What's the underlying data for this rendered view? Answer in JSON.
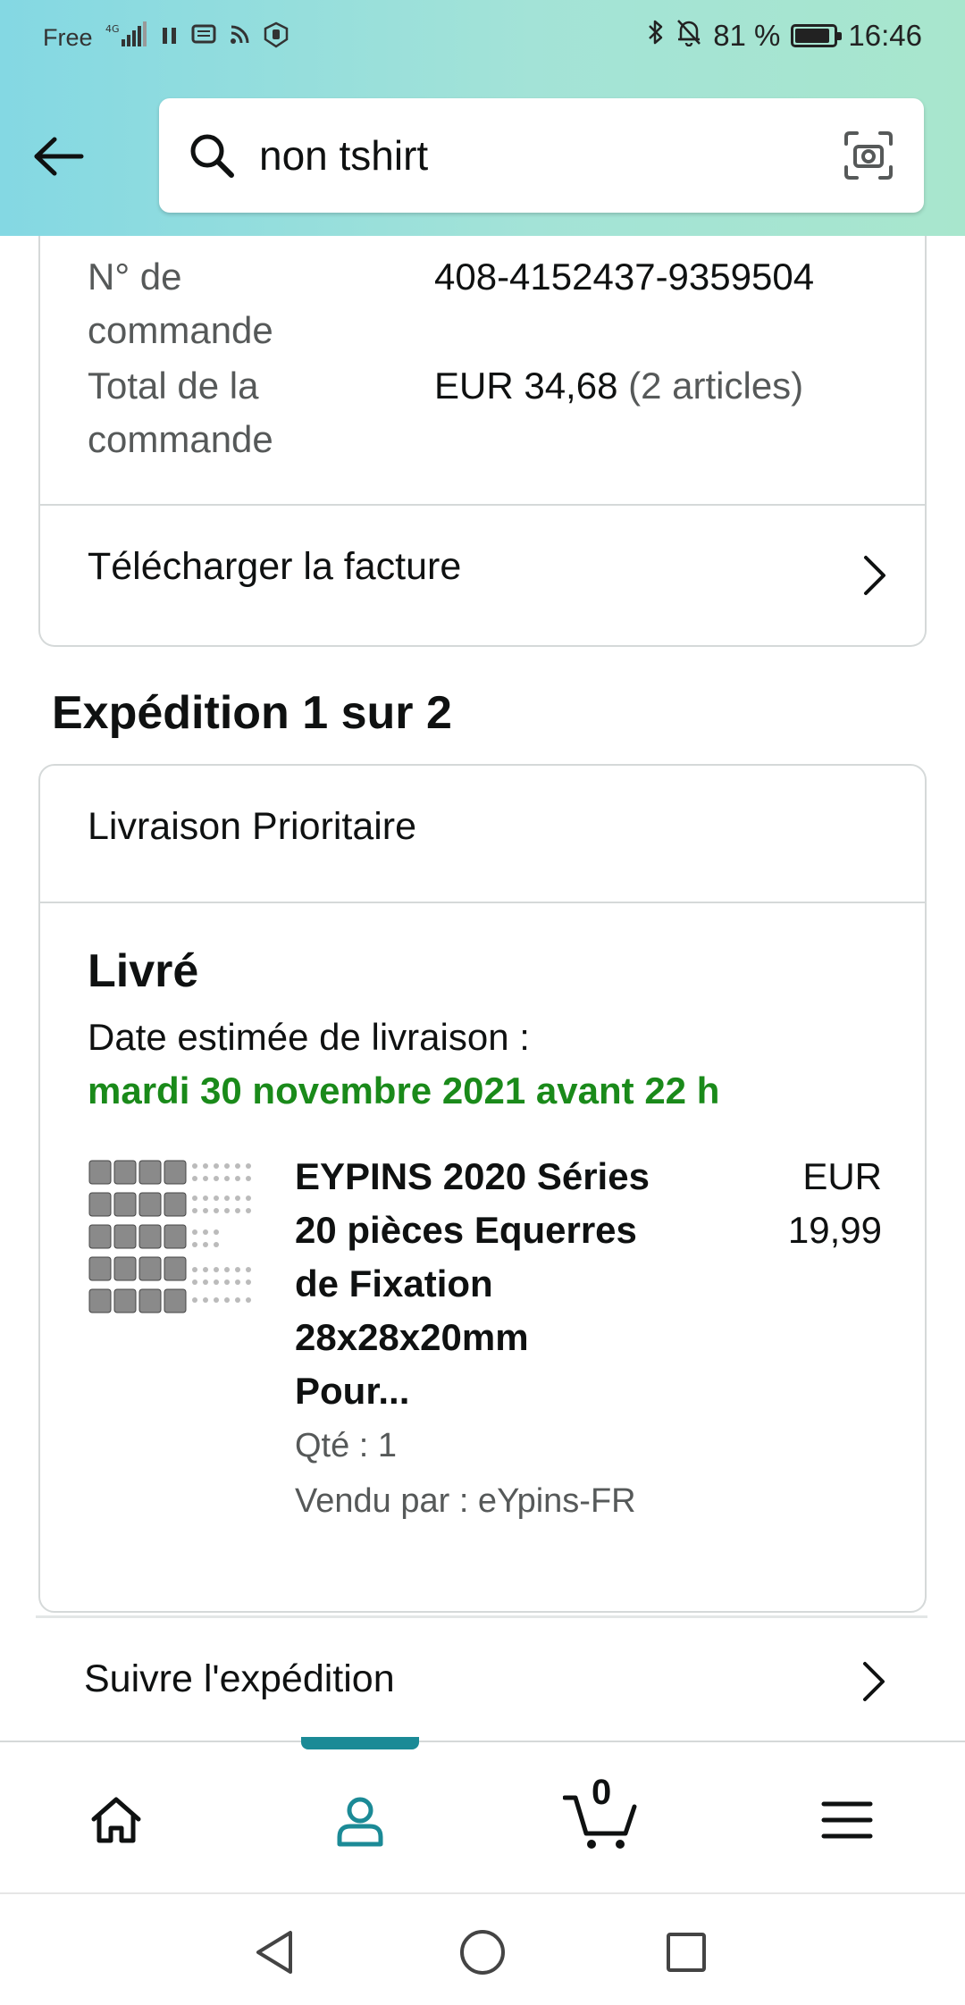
{
  "status_bar": {
    "carrier": "Free",
    "battery_percent": "81 %",
    "time": "16:46"
  },
  "search": {
    "query": "non tshirt"
  },
  "order_summary": {
    "cut_label": "commande",
    "order_number_label": "N° de commande",
    "order_number_label_line1": "N° de",
    "order_number_label_line2": "commande",
    "order_number": "408-4152437-9359504",
    "total_label_line1": "Total de la",
    "total_label_line2": "commande",
    "total_amount": "EUR 34,68",
    "total_items": "(2 articles)",
    "invoice_link": "Télécharger la facture"
  },
  "shipment": {
    "title": "Expédition 1 sur 2",
    "delivery_type": "Livraison Prioritaire",
    "status": "Livré",
    "estimated_label": "Date estimée de livraison :",
    "estimated_date": "mardi 30 novembre 2021 avant 22 h",
    "product": {
      "title_lines": [
        "EYPINS 2020 Séries",
        "20 pièces Equerres",
        "de Fixation",
        "28x28x20mm",
        "Pour..."
      ],
      "price_currency": "EUR",
      "price_value": "19,99",
      "qty": "Qté : 1",
      "seller": "Vendu par : eYpins-FR"
    },
    "track_link": "Suivre l'expédition"
  },
  "bottom_nav": {
    "cart_count": "0",
    "active": "account"
  },
  "colors": {
    "header_gradient_start": "#84d8e3",
    "header_gradient_end": "#a8e6cd",
    "accent": "#1b8a96",
    "delivery_green": "#1a8a1a"
  }
}
